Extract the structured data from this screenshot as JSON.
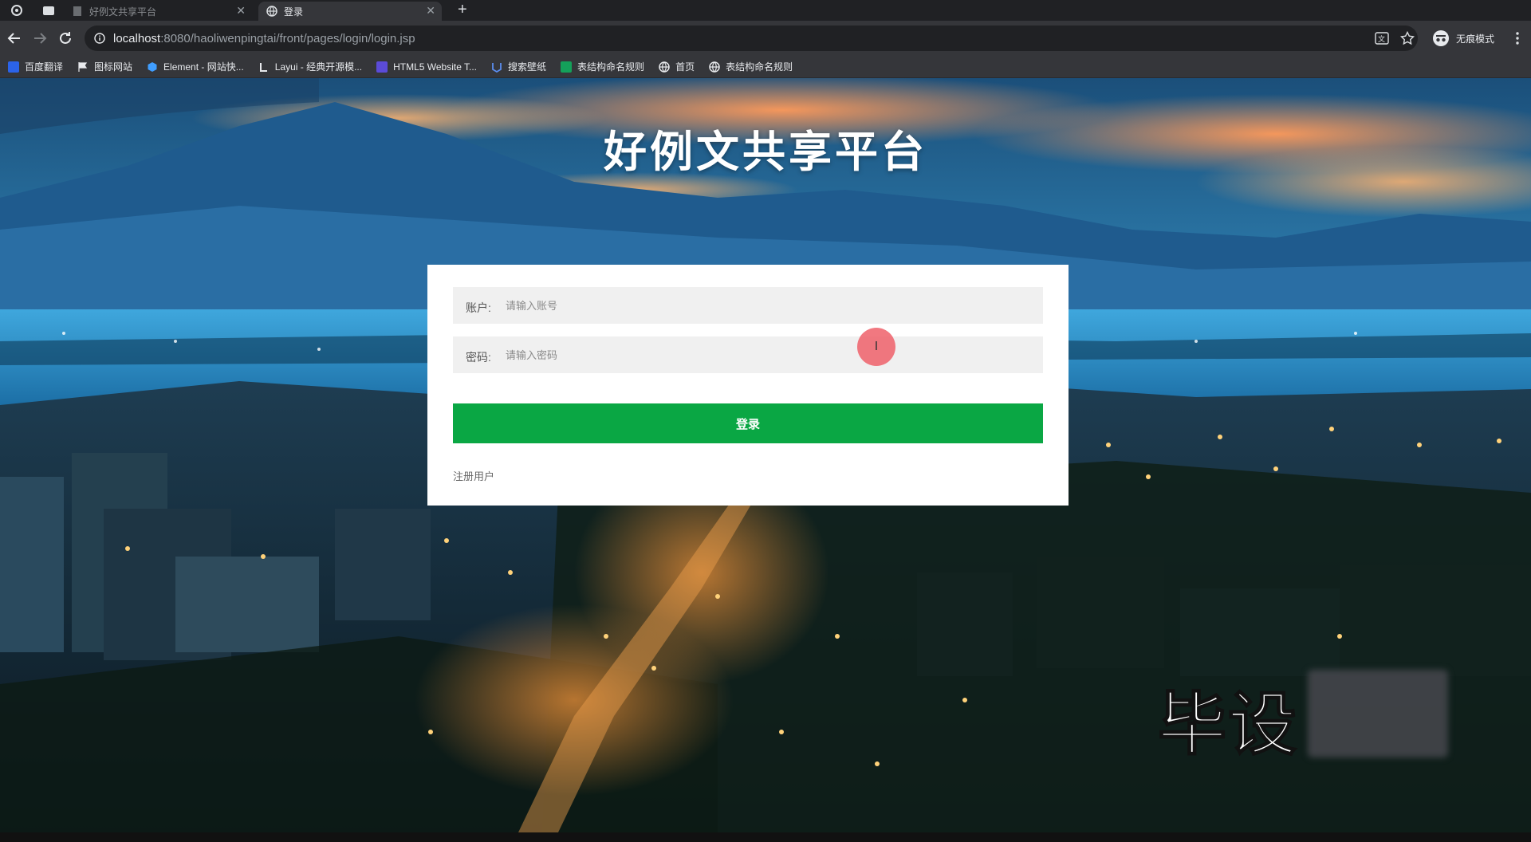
{
  "tabs": [
    {
      "title": "好例文共享平台",
      "active": false
    },
    {
      "title": "登录",
      "active": true
    }
  ],
  "address": {
    "host": "localhost",
    "path": ":8080/haoliwenpingtai/front/pages/login/login.jsp"
  },
  "profile": {
    "label": "无痕模式"
  },
  "bookmarks": [
    {
      "label": "百度翻译",
      "icon": "baidu-translate-icon"
    },
    {
      "label": "图标网站",
      "icon": "flag-icon"
    },
    {
      "label": "Element - 网站快...",
      "icon": "element-icon"
    },
    {
      "label": "Layui - 经典开源模...",
      "icon": "layui-icon"
    },
    {
      "label": "HTML5 Website T...",
      "icon": "html5-icon"
    },
    {
      "label": "搜索壁纸",
      "icon": "wallpaper-icon"
    },
    {
      "label": "表结构命名规则",
      "icon": "sheet-icon"
    },
    {
      "label": "首页",
      "icon": "globe-icon"
    },
    {
      "label": "表结构命名规则",
      "icon": "globe-icon"
    }
  ],
  "page": {
    "title": "好例文共享平台",
    "account_label": "账户:",
    "account_placeholder": "请输入账号",
    "password_label": "密码:",
    "password_placeholder": "请输入密码",
    "login_button": "登录",
    "register_link": "注册用户",
    "watermark": "毕设"
  },
  "colors": {
    "login_button": "#0aa744",
    "chrome_dark": "#202124",
    "chrome_toolbar": "#35363a"
  }
}
